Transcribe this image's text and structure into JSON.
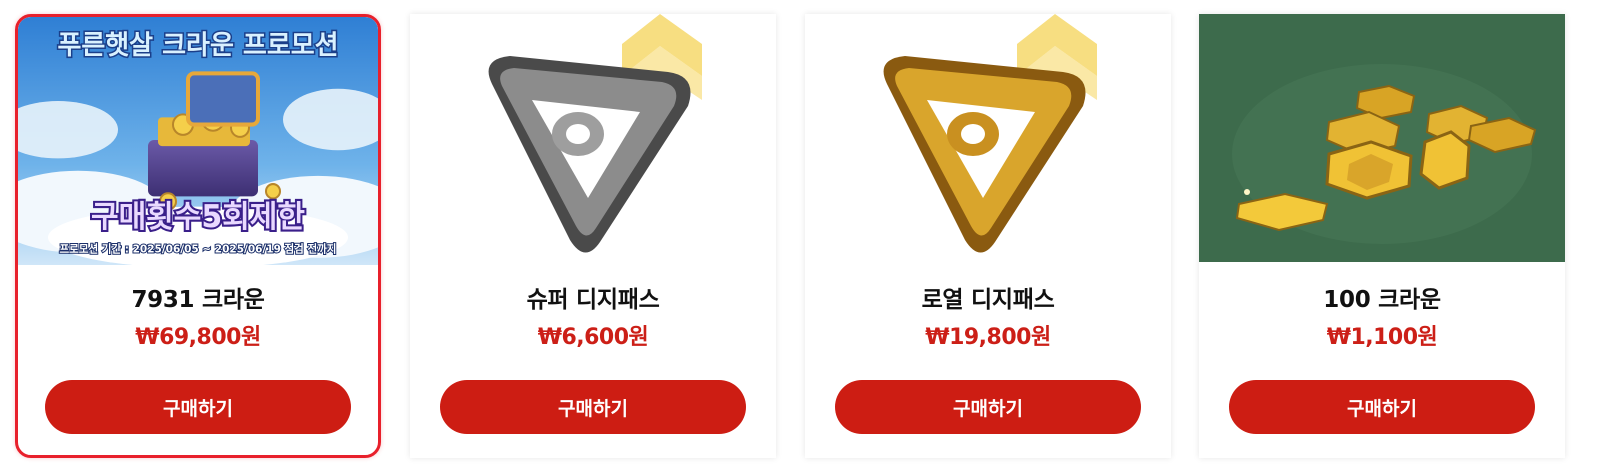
{
  "products": [
    {
      "title": "7931 크라운",
      "price": "₩69,800원",
      "button_label": "구매하기",
      "banner": {
        "headline": "푸른햇살 크라운 프로모션",
        "limit_text": "구매횟수5회제한",
        "period_text": "프로모션 기간 : 2025/06/05 ~ 2025/06/19 점검 전까지"
      },
      "image": "crown-treasure-chest-promo-banner",
      "selected": true
    },
    {
      "title": "슈퍼 디지패스",
      "price": "₩6,600원",
      "button_label": "구매하기",
      "image": "silver-triangle-pass-icon",
      "selected": false
    },
    {
      "title": "로열 디지패스",
      "price": "₩19,800원",
      "button_label": "구매하기",
      "image": "gold-triangle-pass-icon",
      "selected": false
    },
    {
      "title": "100 크라운",
      "price": "₩1,100원",
      "button_label": "구매하기",
      "image": "gold-coins-icon",
      "selected": false
    }
  ],
  "colors": {
    "accent": "#cd1d13",
    "price": "#cc1f17",
    "selected_border": "#e8202b",
    "coin_background": "#3d6b4c"
  }
}
